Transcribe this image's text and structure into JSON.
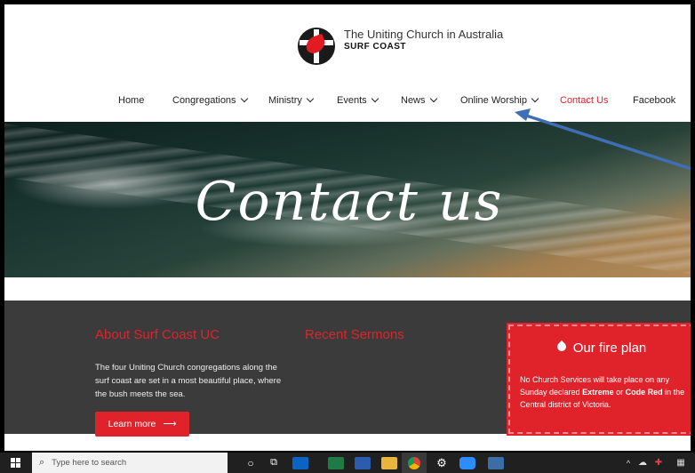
{
  "brand": {
    "line1": "The Uniting Church in Australia",
    "line2": "SURF COAST"
  },
  "nav": {
    "items": [
      {
        "label": "Home",
        "dropdown": false,
        "active": false
      },
      {
        "label": "Congregations",
        "dropdown": true,
        "active": false
      },
      {
        "label": "Ministry",
        "dropdown": true,
        "active": false
      },
      {
        "label": "Events",
        "dropdown": true,
        "active": false
      },
      {
        "label": "News",
        "dropdown": true,
        "active": false
      },
      {
        "label": "Online Worship",
        "dropdown": true,
        "active": false
      },
      {
        "label": "Contact Us",
        "dropdown": false,
        "active": true
      },
      {
        "label": "Facebook",
        "dropdown": false,
        "active": false
      }
    ]
  },
  "hero": {
    "title": "Contact us"
  },
  "footer": {
    "about_title": "About Surf Coast UC",
    "about_text": "The four Uniting Church congregations along the surf coast are set in a most beautiful place, where the bush meets the sea.",
    "learn_more": "Learn more",
    "sermons_title": "Recent Sermons"
  },
  "fire_plan": {
    "title": "Our fire plan",
    "text_1": "No Church Services will take place on any Sunday declared ",
    "extreme": "Extreme",
    "text_2": " or ",
    "code_red": "Code Red",
    "text_3": " in the Central district of Victoria."
  },
  "taskbar": {
    "search_placeholder": "Type here to search"
  },
  "colors": {
    "accent": "#e0232b",
    "footer_bg": "#3b3b3b",
    "arrow": "#3e6fb5"
  }
}
